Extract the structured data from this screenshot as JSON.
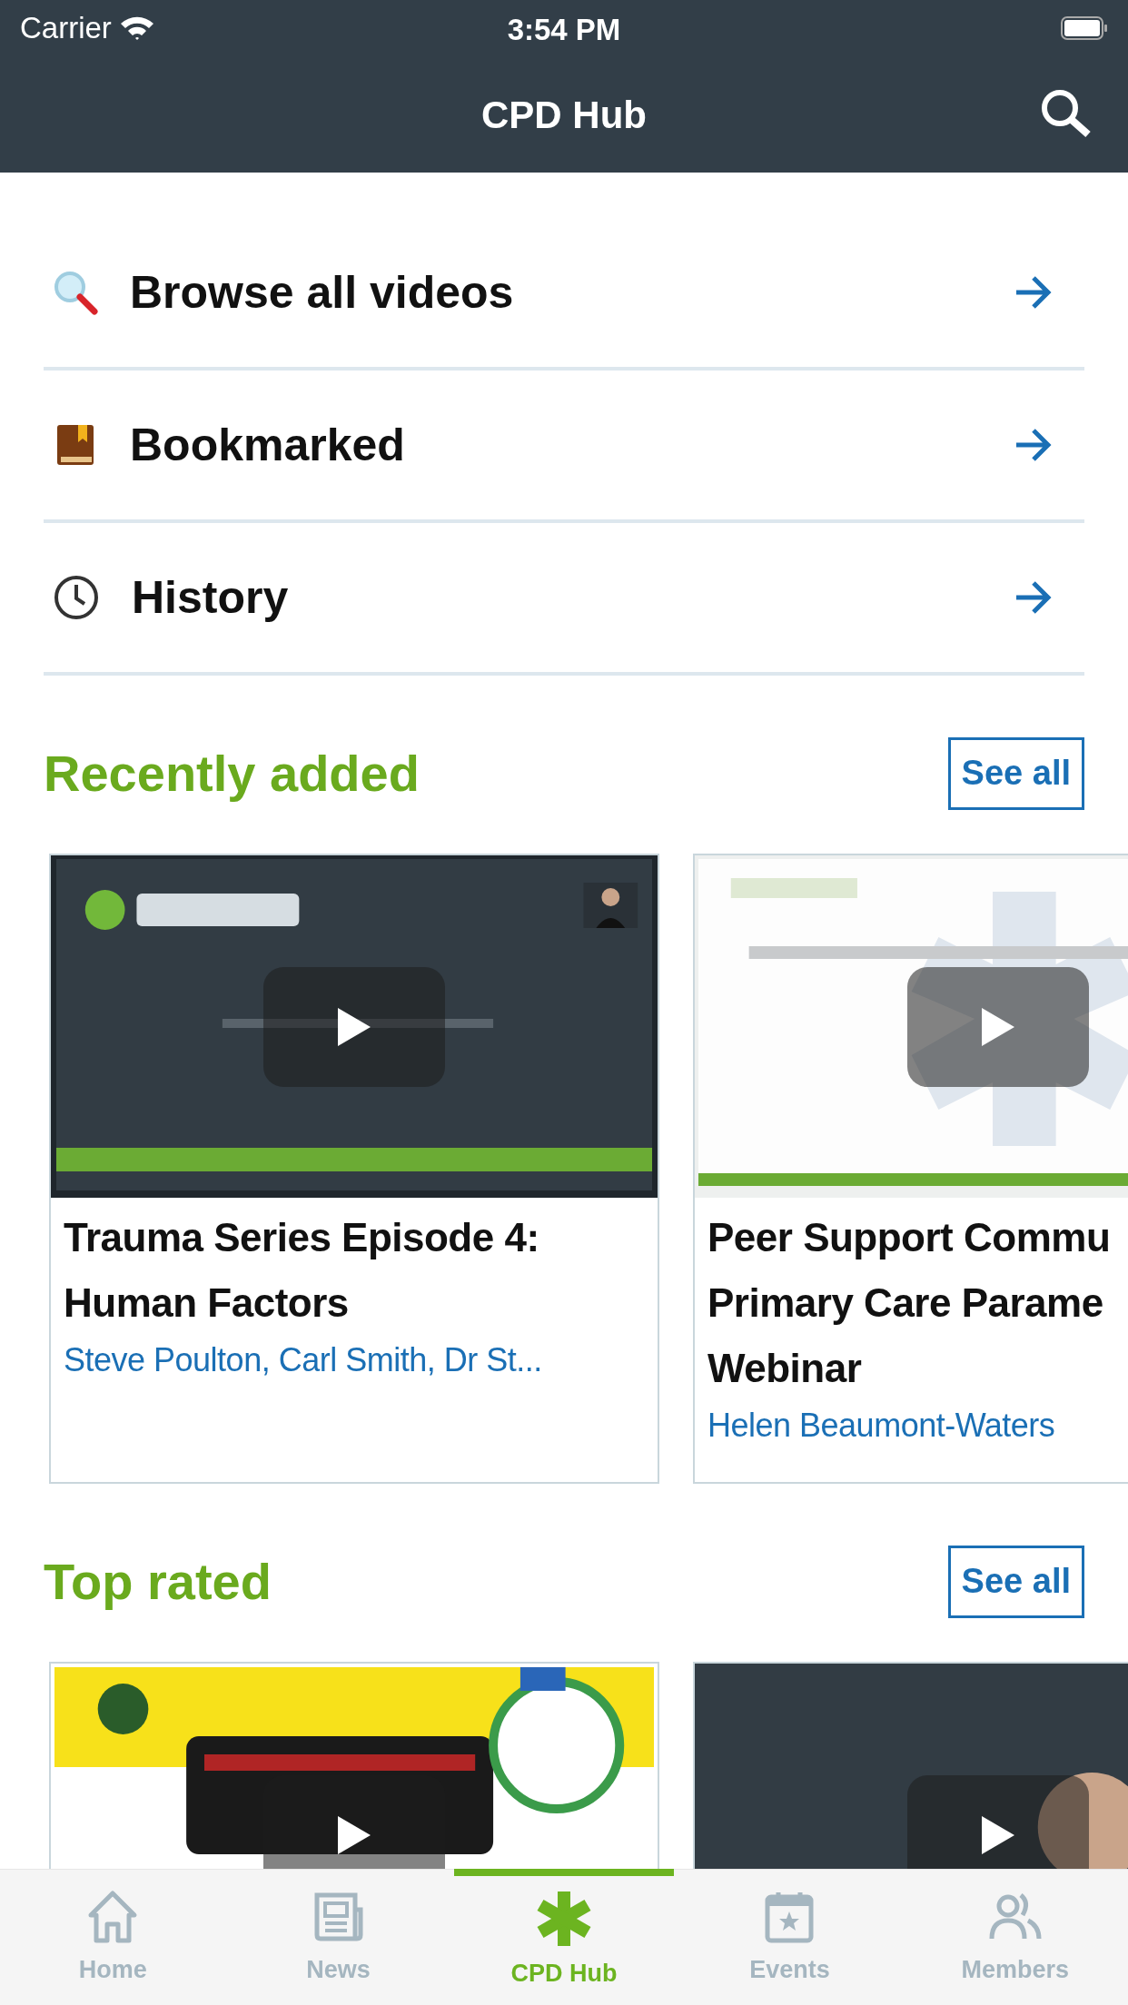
{
  "status_bar": {
    "carrier": "Carrier",
    "time": "3:54 PM"
  },
  "nav_bar": {
    "title": "CPD Hub"
  },
  "menu": [
    {
      "kind": "browse",
      "label": "Browse all videos"
    },
    {
      "kind": "bookmark",
      "label": "Bookmarked"
    },
    {
      "kind": "history",
      "label": "History"
    }
  ],
  "sections": [
    {
      "title": "Recently added",
      "see_all": "See all",
      "videos": [
        {
          "kind": "picture",
          "title": "Trauma Series Episode 4:\nHuman Factors",
          "authors": "Steve Poulton, Carl Smith, Dr St..."
        },
        {
          "kind": "picture",
          "title": "Peer Support Commu\nPrimary Care Parame\nWebinar",
          "authors": "Helen Beaumont-Waters"
        }
      ]
    },
    {
      "title": "Top rated",
      "see_all": "See all"
    }
  ],
  "tab_bar": [
    {
      "kind": "home",
      "label": "Home",
      "selected": false
    },
    {
      "kind": "news",
      "label": "News",
      "selected": false
    },
    {
      "kind": "cpd",
      "label": "CPD Hub",
      "selected": true
    },
    {
      "kind": "events",
      "label": "Events",
      "selected": false
    },
    {
      "kind": "members",
      "label": "Members",
      "selected": false
    }
  ]
}
